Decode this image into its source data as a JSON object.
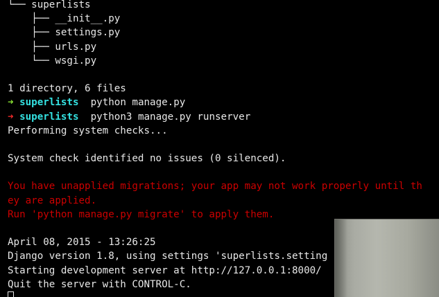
{
  "colors": {
    "background": "#000000",
    "text": "#e8e8e8",
    "arrow_success": "#8ae234",
    "arrow_error": "#ef2929",
    "prompt_dir": "#34e2e2",
    "warning": "#cc0000"
  },
  "tree": {
    "root_glyph": "└── ",
    "root": "superlists",
    "items": [
      {
        "glyph": "    ├── ",
        "name": "__init__.py"
      },
      {
        "glyph": "    ├── ",
        "name": "settings.py"
      },
      {
        "glyph": "    ├── ",
        "name": "urls.py"
      },
      {
        "glyph": "    └── ",
        "name": "wsgi.py"
      }
    ],
    "summary": "1 directory, 6 files"
  },
  "prompts": [
    {
      "arrow": "➜",
      "status": "success",
      "dir": "superlists",
      "command": "python manage.py"
    },
    {
      "arrow": "➜",
      "status": "error",
      "dir": "superlists",
      "command": "python3 manage.py runserver"
    }
  ],
  "output": {
    "checks": "Performing system checks...",
    "check_result": "System check identified no issues (0 silenced).",
    "warning_lines": [
      "You have unapplied migrations; your app may not work properly until th",
      "ey are applied.",
      "Run 'python manage.py migrate' to apply them."
    ],
    "date": "April 08, 2015 - 13:26:25",
    "django_version": "Django version 1.8, using settings 'superlists.setting",
    "server_start": "Starting development server at http://127.0.0.1:8000/",
    "quit_hint": "Quit the server with CONTROL-C."
  },
  "cursor_icon": "block-cursor-icon",
  "overlay_icon": "webcam-overlay"
}
